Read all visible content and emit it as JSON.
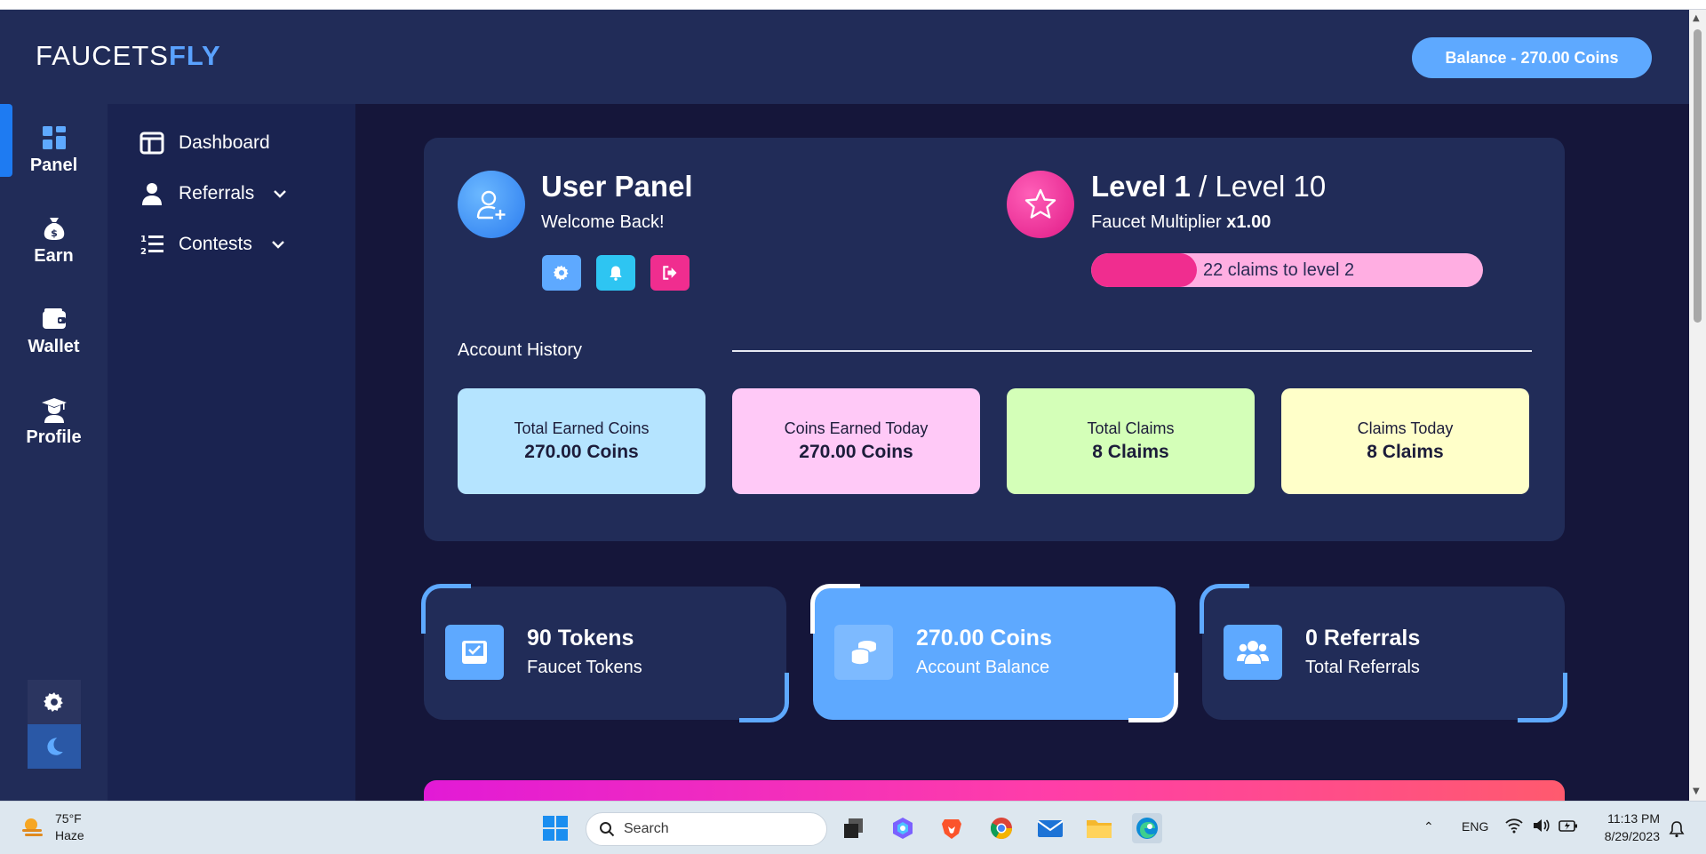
{
  "brand": {
    "logo_thin": "FAUCETS",
    "logo_bold": "FLY"
  },
  "header": {
    "balance_label": "Balance - 270.00 Coins"
  },
  "rail": {
    "items": [
      {
        "label": "Panel",
        "icon": "grid-icon"
      },
      {
        "label": "Earn",
        "icon": "money-bag-icon"
      },
      {
        "label": "Wallet",
        "icon": "wallet-icon"
      },
      {
        "label": "Profile",
        "icon": "graduate-icon"
      }
    ],
    "active_index": 0
  },
  "submenu": {
    "items": [
      {
        "label": "Dashboard",
        "icon": "dashboard-icon",
        "has_chevron": false
      },
      {
        "label": "Referrals",
        "icon": "user-icon",
        "has_chevron": true
      },
      {
        "label": "Contests",
        "icon": "list-ordered-icon",
        "has_chevron": true
      }
    ]
  },
  "user_panel": {
    "title": "User Panel",
    "subtitle": "Welcome Back!",
    "buttons": [
      "settings-icon",
      "bell-icon",
      "logout-icon"
    ]
  },
  "level": {
    "current": "Level 1",
    "separator": " / ",
    "max": "Level 10",
    "multiplier_label": "Faucet Multiplier",
    "multiplier_value": "x1.00",
    "progress_text": "22 claims to level 2",
    "progress_fraction": 0.27
  },
  "account_history": {
    "title": "Account History",
    "stats": [
      {
        "label": "Total Earned Coins",
        "value": "270.00 Coins",
        "color": "#b5e4ff"
      },
      {
        "label": "Coins Earned Today",
        "value": "270.00 Coins",
        "color": "#ffc9f7"
      },
      {
        "label": "Total Claims",
        "value": "8 Claims",
        "color": "#d4ffb8"
      },
      {
        "label": "Claims Today",
        "value": "8 Claims",
        "color": "#ffffc9"
      }
    ]
  },
  "metric_cards": [
    {
      "value": "90 Tokens",
      "label": "Faucet Tokens",
      "icon": "inbox-check-icon",
      "highlight": false
    },
    {
      "value": "270.00 Coins",
      "label": "Account Balance",
      "icon": "coins-icon",
      "highlight": true
    },
    {
      "value": "0 Referrals",
      "label": "Total Referrals",
      "icon": "users-icon",
      "highlight": false
    }
  ],
  "colors": {
    "accent": "#5ea9ff",
    "panel_bg": "#212c58",
    "page_bg": "#15163a",
    "pink": "#f02d8f"
  },
  "taskbar": {
    "weather_temp": "75°F",
    "weather_desc": "Haze",
    "search_placeholder": "Search",
    "language": "ENG",
    "time": "11:13 PM",
    "date": "8/29/2023"
  }
}
